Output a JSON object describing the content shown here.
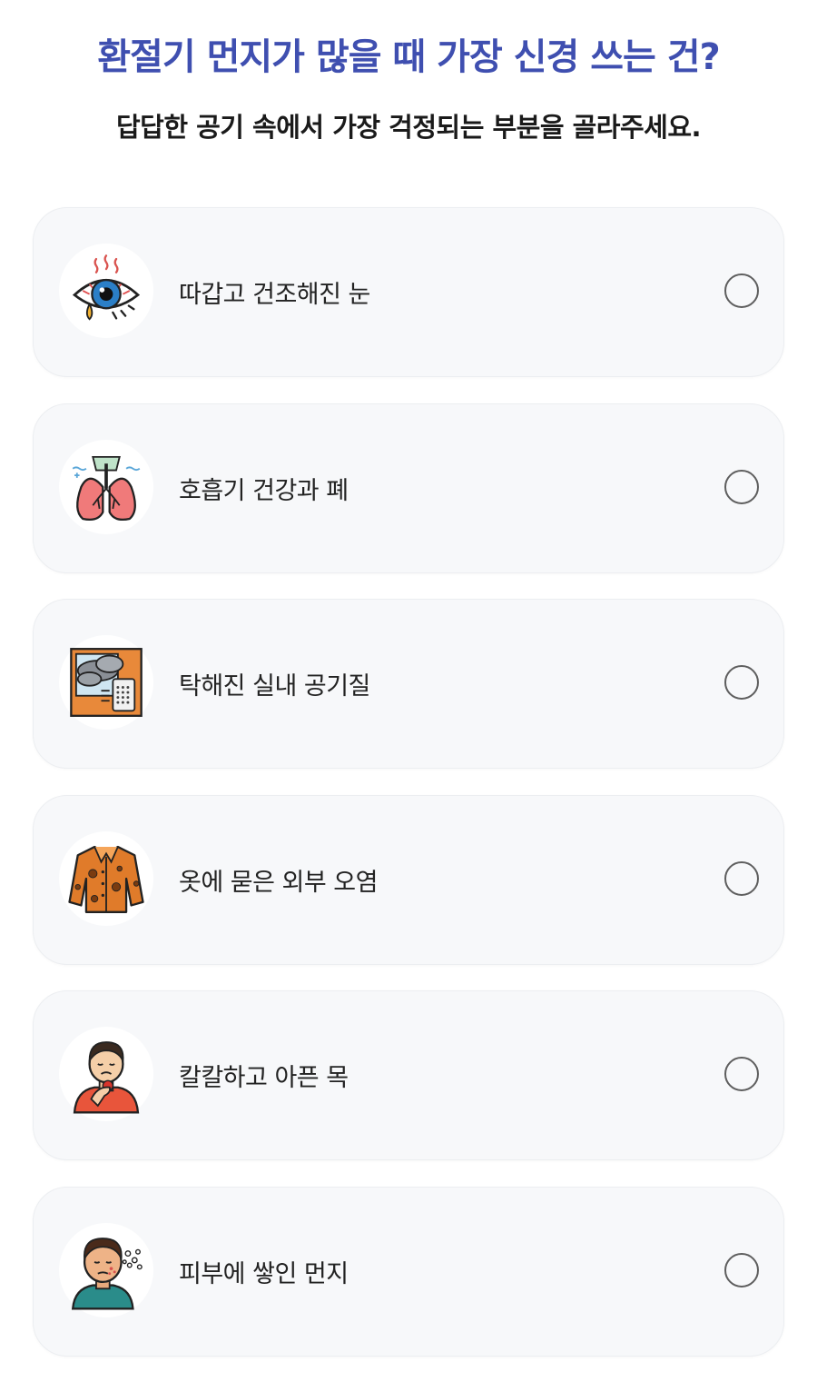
{
  "header": {
    "title": "환절기 먼지가 많을 때 가장 신경 쓰는 건?",
    "subtitle": "답답한 공기 속에서 가장 걱정되는 부분을 골라주세요."
  },
  "options": [
    {
      "label": "따갑고 건조해진 눈",
      "icon": "irritated-eye-icon",
      "selected": false
    },
    {
      "label": "호흡기 건강과 폐",
      "icon": "lungs-icon",
      "selected": false
    },
    {
      "label": "탁해진 실내 공기질",
      "icon": "indoor-air-purifier-icon",
      "selected": false
    },
    {
      "label": "옷에 묻은 외부 오염",
      "icon": "dusty-jacket-icon",
      "selected": false
    },
    {
      "label": "칼칼하고 아픈 목",
      "icon": "sore-throat-icon",
      "selected": false
    },
    {
      "label": "피부에 쌓인 먼지",
      "icon": "skin-dust-icon",
      "selected": false
    }
  ],
  "colors": {
    "title": "#3f4fb0",
    "card_background": "#f7f8fa",
    "radio_border": "#5e5e5e"
  }
}
